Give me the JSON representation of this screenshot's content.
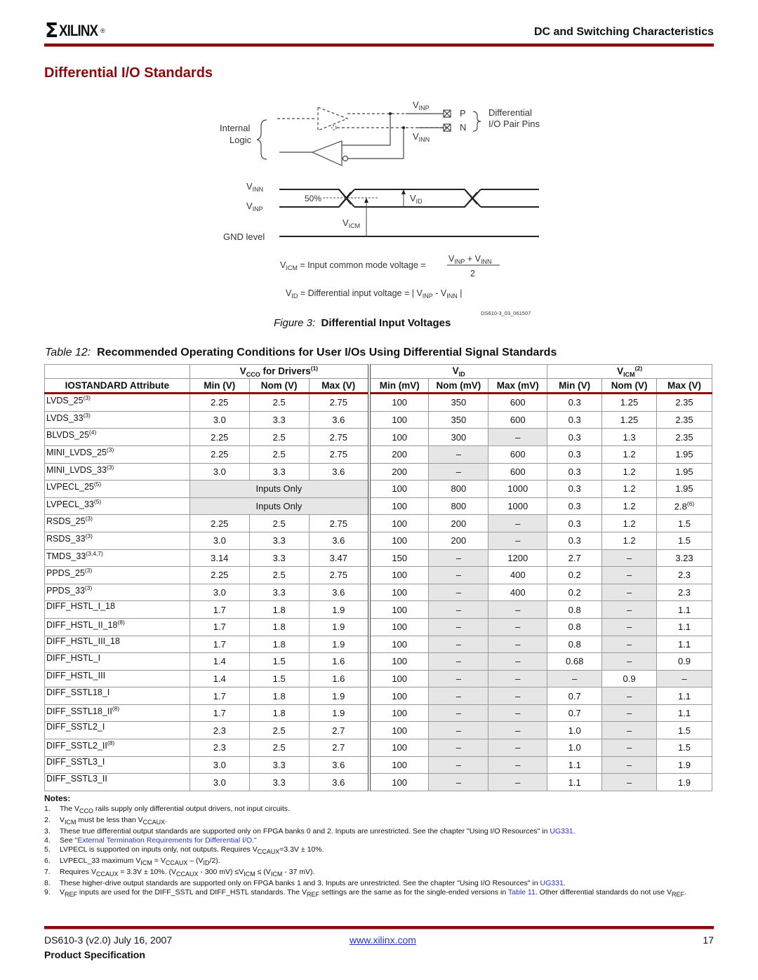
{
  "header": {
    "logo_mark": "Σ",
    "logo_text": "XILINX",
    "logo_reg": "®",
    "section": "DC and Switching Characteristics"
  },
  "page_title": "Differential I/O Standards",
  "figure": {
    "labels": {
      "internal": "Internal",
      "logic": "Logic",
      "vinp": "V",
      "vinp_sub": "INP",
      "vinn": "V",
      "vinn_sub": "INN",
      "pin_p": "P",
      "pin_n": "N",
      "diff1": "Differential",
      "diff2": "I/O Pair Pins",
      "wave_vinn_sub": "INN",
      "wave_vinp_sub": "INP",
      "pct": "50%",
      "vid_sub": "ID",
      "vicm_sub": "ICM",
      "gnd": "GND level",
      "eq1_text": " = Input common mode voltage = ",
      "eq1_num": "V",
      "eq1_num_sub1": "INP",
      "eq1_plus": " + V",
      "eq1_num_sub2": "INN",
      "eq1_den": "2",
      "eq2_text": " = Differential input voltage = ",
      "eq2_minus": " - V",
      "fig_id": "DS610-3_03_061507"
    },
    "caption_prefix": "Figure 3:",
    "caption": "Differential Input Voltages"
  },
  "table": {
    "title_prefix": "Table  12:",
    "title": "Recommended Operating Conditions for User I/Os Using Differential Signal Standards",
    "group_headers": [
      {
        "main": "V",
        "sub": "CCO",
        "rest": " for Drivers",
        "sup": "(1)"
      },
      {
        "main": "V",
        "sub": "ID",
        "rest": "",
        "sup": ""
      },
      {
        "main": "V",
        "sub": "ICM",
        "rest": "",
        "sup": "(2)"
      }
    ],
    "col_headers": [
      "IOSTANDARD Attribute",
      "Min (V)",
      "Nom (V)",
      "Max (V)",
      "Min (mV)",
      "Nom (mV)",
      "Max (mV)",
      "Min (V)",
      "Nom (V)",
      "Max (V)"
    ],
    "rows": [
      {
        "name": "LVDS_25",
        "sup": "(3)",
        "cells": [
          "2.25",
          "2.5",
          "2.75",
          "100",
          "350",
          "600",
          "0.3",
          "1.25",
          "2.35"
        ],
        "gray": []
      },
      {
        "name": "LVDS_33",
        "sup": "(3)",
        "cells": [
          "3.0",
          "3.3",
          "3.6",
          "100",
          "350",
          "600",
          "0.3",
          "1.25",
          "2.35"
        ],
        "gray": []
      },
      {
        "name": "BLVDS_25",
        "sup": "(4)",
        "cells": [
          "2.25",
          "2.5",
          "2.75",
          "100",
          "300",
          "–",
          "0.3",
          "1.3",
          "2.35"
        ],
        "gray": [
          5
        ]
      },
      {
        "name": "MINI_LVDS_25",
        "sup": "(3)",
        "cells": [
          "2.25",
          "2.5",
          "2.75",
          "200",
          "–",
          "600",
          "0.3",
          "1.2",
          "1.95"
        ],
        "gray": [
          4
        ]
      },
      {
        "name": "MINI_LVDS_33",
        "sup": "(3)",
        "cells": [
          "3.0",
          "3.3",
          "3.6",
          "200",
          "–",
          "600",
          "0.3",
          "1.2",
          "1.95"
        ],
        "gray": [
          4
        ]
      },
      {
        "name": "LVPECL_25",
        "sup": "(5)",
        "span": "Inputs Only",
        "cells": [
          "100",
          "800",
          "1000",
          "0.3",
          "1.2",
          "1.95"
        ],
        "gray": []
      },
      {
        "name": "LVPECL_33",
        "sup": "(5)",
        "span": "Inputs Only",
        "cells": [
          "100",
          "800",
          "1000",
          "0.3",
          "1.2",
          "2.8"
        ],
        "last_sup": "(6)",
        "gray": []
      },
      {
        "name": "RSDS_25",
        "sup": "(3)",
        "cells": [
          "2.25",
          "2.5",
          "2.75",
          "100",
          "200",
          "–",
          "0.3",
          "1.2",
          "1.5"
        ],
        "gray": [
          5
        ]
      },
      {
        "name": "RSDS_33",
        "sup": "(3)",
        "cells": [
          "3.0",
          "3.3",
          "3.6",
          "100",
          "200",
          "–",
          "0.3",
          "1.2",
          "1.5"
        ],
        "gray": [
          5
        ]
      },
      {
        "name": "TMDS_33",
        "sup": "(3,4,7)",
        "cells": [
          "3.14",
          "3.3",
          "3.47",
          "150",
          "–",
          "1200",
          "2.7",
          "–",
          "3.23"
        ],
        "gray": [
          4,
          7
        ]
      },
      {
        "name": "PPDS_25",
        "sup": "(3)",
        "cells": [
          "2.25",
          "2.5",
          "2.75",
          "100",
          "–",
          "400",
          "0.2",
          "–",
          "2.3"
        ],
        "gray": [
          4,
          7
        ]
      },
      {
        "name": "PPDS_33",
        "sup": "(3)",
        "cells": [
          "3.0",
          "3.3",
          "3.6",
          "100",
          "–",
          "400",
          "0.2",
          "–",
          "2.3"
        ],
        "gray": [
          4,
          7
        ]
      },
      {
        "name": "DIFF_HSTL_I_18",
        "sup": "",
        "cells": [
          "1.7",
          "1.8",
          "1.9",
          "100",
          "–",
          "–",
          "0.8",
          "–",
          "1.1"
        ],
        "gray": [
          4,
          5,
          7
        ]
      },
      {
        "name": "DIFF_HSTL_II_18",
        "sup": "(8)",
        "cells": [
          "1.7",
          "1.8",
          "1.9",
          "100",
          "–",
          "–",
          "0.8",
          "–",
          "1.1"
        ],
        "gray": [
          4,
          5,
          7
        ]
      },
      {
        "name": "DIFF_HSTL_III_18",
        "sup": "",
        "cells": [
          "1.7",
          "1.8",
          "1.9",
          "100",
          "–",
          "–",
          "0.8",
          "–",
          "1.1"
        ],
        "gray": [
          4,
          5,
          7
        ]
      },
      {
        "name": "DIFF_HSTL_I",
        "sup": "",
        "cells": [
          "1.4",
          "1.5",
          "1.6",
          "100",
          "–",
          "–",
          "0.68",
          "–",
          "0.9"
        ],
        "gray": [
          4,
          5,
          7
        ]
      },
      {
        "name": "DIFF_HSTL_III",
        "sup": "",
        "cells": [
          "1.4",
          "1.5",
          "1.6",
          "100",
          "–",
          "–",
          "–",
          "0.9",
          "–"
        ],
        "gray": [
          4,
          5,
          6,
          8
        ],
        "dash": true
      },
      {
        "name": "DIFF_SSTL18_I",
        "sup": "",
        "cells": [
          "1.7",
          "1.8",
          "1.9",
          "100",
          "–",
          "–",
          "0.7",
          "–",
          "1.1"
        ],
        "gray": [
          4,
          5,
          7
        ]
      },
      {
        "name": "DIFF_SSTL18_II",
        "sup": "(8)",
        "cells": [
          "1.7",
          "1.8",
          "1.9",
          "100",
          "–",
          "–",
          "0.7",
          "–",
          "1.1"
        ],
        "gray": [
          4,
          5,
          7
        ]
      },
      {
        "name": "DIFF_SSTL2_I",
        "sup": "",
        "cells": [
          "2.3",
          "2.5",
          "2.7",
          "100",
          "–",
          "–",
          "1.0",
          "–",
          "1.5"
        ],
        "gray": [
          4,
          5,
          7
        ]
      },
      {
        "name": "DIFF_SSTL2_II",
        "sup": "(8)",
        "cells": [
          "2.3",
          "2.5",
          "2.7",
          "100",
          "–",
          "–",
          "1.0",
          "–",
          "1.5"
        ],
        "gray": [
          4,
          5,
          7
        ]
      },
      {
        "name": "DIFF_SSTL3_I",
        "sup": "",
        "cells": [
          "3.0",
          "3.3",
          "3.6",
          "100",
          "–",
          "–",
          "1.1",
          "–",
          "1.9"
        ],
        "gray": [
          4,
          5,
          7
        ]
      },
      {
        "name": "DIFF_SSTL3_II",
        "sup": "",
        "cells": [
          "3.0",
          "3.3",
          "3.6",
          "100",
          "–",
          "–",
          "1.1",
          "–",
          "1.9"
        ],
        "gray": [
          4,
          5,
          7
        ]
      }
    ]
  },
  "notes": {
    "title": "Notes:",
    "items": [
      {
        "num": "1.",
        "html": "The V<sub>CCO</sub> rails supply only differential output drivers, not input circuits."
      },
      {
        "num": "2.",
        "html": "V<sub>ICM</sub> must be less than V<sub>CCAUX</sub>."
      },
      {
        "num": "3.",
        "html": "These true differential output standards are supported only on FPGA banks 0 and 2. Inputs are unrestricted. See the chapter \"Using I/O Resources\" in <a class=\"lnk\" data-name=\"link-ug331\" data-interactable=\"true\">UG331</a>."
      },
      {
        "num": "4.",
        "html": "See <a class=\"lnk\" data-name=\"link-external-termination\" data-interactable=\"true\">\"External Termination Requirements for Differential I/O.\"</a>"
      },
      {
        "num": "5.",
        "html": "LVPECL is supported on inputs only, not outputs. Requires V<sub>CCAUX</sub>=3.3V ± 10%."
      },
      {
        "num": "6.",
        "html": "LVPECL_33 maximum V<sub>ICM</sub> = V<sub>CCAUX</sub> – (V<sub>ID</sub>/2)."
      },
      {
        "num": "7.",
        "html": "Requires V<sub>CCAUX</sub> = 3.3V ± 10%. (V<sub>CCAUX</sub> - 300 mV) ≤V<sub>ICM</sub> ≤ (V<sub>ICM</sub> - 37 mV)."
      },
      {
        "num": "8.",
        "html": "These higher-drive output standards are supported only on FPGA banks 1 and 3. Inputs are unrestricted. See the chapter \"Using I/O Resources\" in <a class=\"lnk\" data-name=\"link-ug331\" data-interactable=\"true\">UG331</a>."
      },
      {
        "num": "9.",
        "html": "V<sub>REF</sub> inputs are used for the DIFF_SSTL and DIFF_HSTL standards. The V<sub>REF</sub> settings are the same as for the single-ended versions in <a class=\"lnk\" data-name=\"link-table-11\" data-interactable=\"true\">Table 11</a>. Other differential standards do not use V<sub>REF</sub>."
      }
    ]
  },
  "footer": {
    "doc": "DS610-3 (v2.0) July 16, 2007",
    "product": "Product Specification",
    "link": "www.xilinx.com",
    "page": "17"
  },
  "colors": {
    "brand": "#8b0a0a",
    "link": "#2233cc",
    "cell_gray": "#e6e6e6"
  }
}
